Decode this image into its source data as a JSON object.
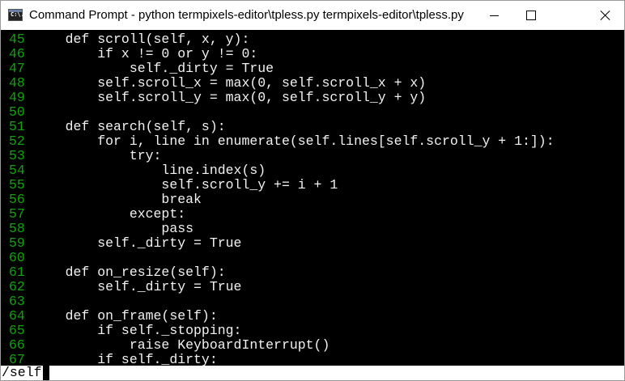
{
  "window": {
    "title": "Command Prompt - python  termpixels-editor\\tpless.py termpixels-editor\\tpless.py",
    "icon_label": "C:\\."
  },
  "editor": {
    "lines": [
      {
        "n": "45",
        "text": "    def scroll(self, x, y):"
      },
      {
        "n": "46",
        "text": "        if x != 0 or y != 0:"
      },
      {
        "n": "47",
        "text": "            self._dirty = True"
      },
      {
        "n": "48",
        "text": "        self.scroll_x = max(0, self.scroll_x + x)"
      },
      {
        "n": "49",
        "text": "        self.scroll_y = max(0, self.scroll_y + y)"
      },
      {
        "n": "50",
        "text": ""
      },
      {
        "n": "51",
        "text": "    def search(self, s):"
      },
      {
        "n": "52",
        "text": "        for i, line in enumerate(self.lines[self.scroll_y + 1:]):"
      },
      {
        "n": "53",
        "text": "            try:"
      },
      {
        "n": "54",
        "text": "                line.index(s)"
      },
      {
        "n": "55",
        "text": "                self.scroll_y += i + 1"
      },
      {
        "n": "56",
        "text": "                break"
      },
      {
        "n": "57",
        "text": "            except:"
      },
      {
        "n": "58",
        "text": "                pass"
      },
      {
        "n": "59",
        "text": "        self._dirty = True"
      },
      {
        "n": "60",
        "text": ""
      },
      {
        "n": "61",
        "text": "    def on_resize(self):"
      },
      {
        "n": "62",
        "text": "        self._dirty = True"
      },
      {
        "n": "63",
        "text": ""
      },
      {
        "n": "64",
        "text": "    def on_frame(self):"
      },
      {
        "n": "65",
        "text": "        if self._stopping:"
      },
      {
        "n": "66",
        "text": "            raise KeyboardInterrupt()"
      },
      {
        "n": "67",
        "text": "        if self._dirty:"
      }
    ]
  },
  "command_line": {
    "input": "/self"
  },
  "colors": {
    "line_number": "#13a10e",
    "code_text": "#f2f2f2",
    "background": "#000000",
    "command_bar": "#ffffff"
  }
}
